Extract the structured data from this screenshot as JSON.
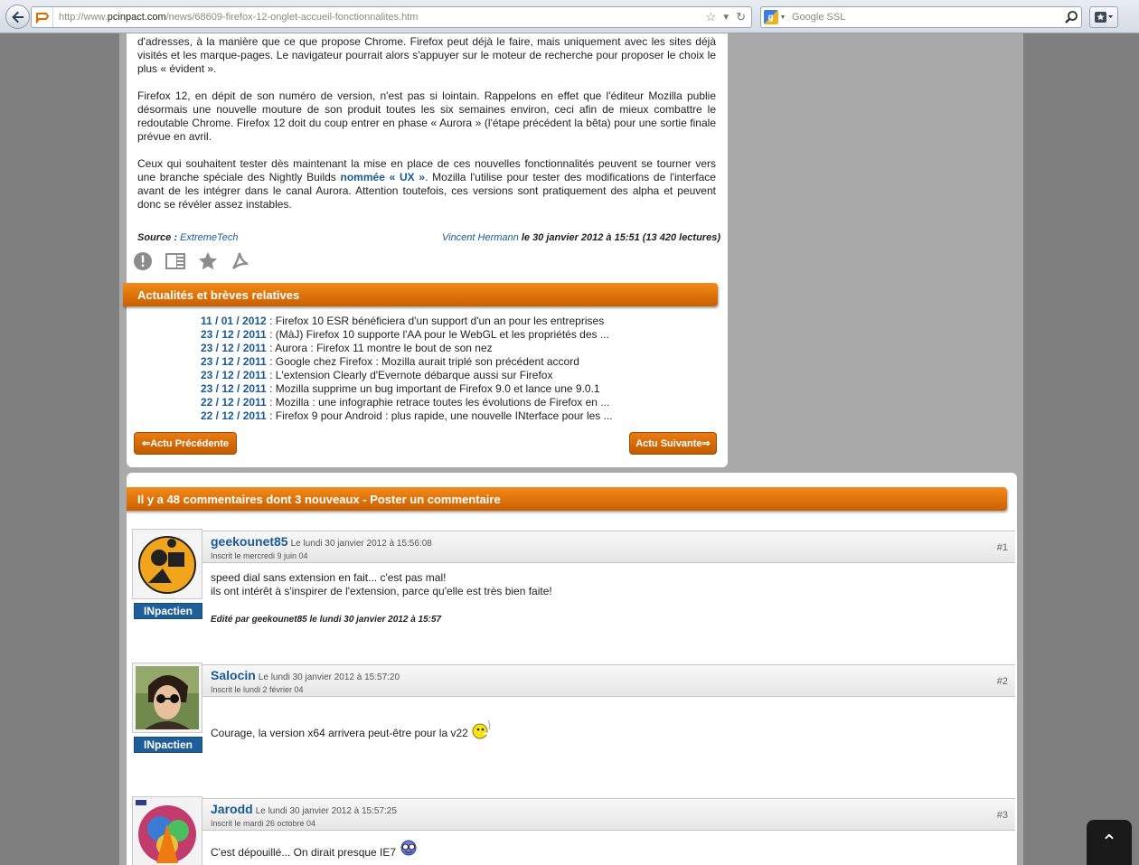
{
  "browser": {
    "url_prefix": "http://www.",
    "url_host": "pcinpact.com",
    "url_path": "/news/68609-firefox-12-onglet-accueil-fonctionnalites.htm",
    "search_placeholder": "Google SSL"
  },
  "article": {
    "para1": "d'adresses, à la manière que ce que propose Chrome. Firefox peut déjà le faire, mais uniquement avec les sites déjà visités et les marque-pages. Le navigateur pourrait alors s'appuyer sur le moteur de recherche pour proposer le choix le plus « évident ».",
    "para2": "Firefox 12, en dépit de son numéro de version, n'est pas si lointain. Rappelons en effet que l'éditeur Mozilla publie désormais une nouvelle mouture de son produit toutes les six semaines environ, ceci afin de mieux combattre le redoutable Chrome. Firefox 12 doit du coup entrer en phase « Aurora » (l'étape précédent la bêta) pour une sortie finale prévue en avril.",
    "para3_before": "Ceux qui souhaitent tester dès maintenant la mise en place de ces nouvelles fonctionnalités peuvent se tourner vers une branche spéciale des Nightly Builds ",
    "para3_link": "nommée « UX »",
    "para3_after": ". Mozilla l'utilise pour tester des modifications de l'interface avant de les intégrer dans le canal Aurora. Attention toutefois, ces versions sont pratiquement des alpha et peuvent donc se révéler assez instables.",
    "source_label": "Source : ",
    "source_link": "ExtremeTech",
    "author": "Vincent Hermann",
    "date_info": " le 30 janvier 2012 à 15:51 (13 420 lectures)"
  },
  "related": {
    "title": "Actualités et brèves relatives",
    "items": [
      {
        "date": "11 / 01 / 2012",
        "text": " : Firefox 10 ESR bénéficiera d'un support d'un an pour les entreprises"
      },
      {
        "date": "23 / 12 / 2011",
        "text": " : (MàJ) Firefox 10 supporte l'AA pour le WebGL et les propriétés des ..."
      },
      {
        "date": "23 / 12 / 2011",
        "text": " : Aurora : Firefox 11 montre le bout de son nez"
      },
      {
        "date": "23 / 12 / 2011",
        "text": " : Google chez Firefox : Mozilla aurait triplé son précédent accord"
      },
      {
        "date": "23 / 12 / 2011",
        "text": " : L'extension Clearly d'Evernote débarque aussi sur Firefox"
      },
      {
        "date": "23 / 12 / 2011",
        "text": " : Mozilla supprime un bug important de Firefox 9.0 et lance une 9.0.1"
      },
      {
        "date": "22 / 12 / 2011",
        "text": " : Mozilla : une infographie retrace toutes les évolutions de Firefox en ..."
      },
      {
        "date": "22 / 12 / 2011",
        "text": " : Firefox 9 pour Android : plus rapide, une nouvelle INterface pour les ..."
      }
    ],
    "prev_label": "⇐Actu Précédente",
    "next_label": "Actu Suivante⇒"
  },
  "comments": {
    "title": "Il y a 48 commentaires dont 3 nouveaux - Poster un commentaire",
    "items": [
      {
        "user": "geekounet85",
        "date": "Le lundi 30 janvier 2012 à 15:56:08",
        "since": "Inscrit le mercredi 9 juin 04",
        "num": "#1",
        "badge": "INpactien",
        "line1": "speed dial sans extension en fait... c'est pas mal!",
        "line2": "ils ont intérêt à s'inspirer de l'extension, parce qu'elle est très bien faite!",
        "edit": "Edité par geekounet85 le lundi 30 janvier 2012 à 15:57"
      },
      {
        "user": "Salocin",
        "date": "Le lundi 30 janvier 2012 à 15:57:20",
        "since": "Inscrit le lundi 2 février 04",
        "num": "#2",
        "badge": "INpactien",
        "line1": "Courage, la version x64 arrivera peut-être pour la v22"
      },
      {
        "user": "Jarodd",
        "date": "Le lundi 30 janvier 2012 à 15:57:25",
        "since": "Inscrit le mardi 26 octobre 04",
        "num": "#3",
        "line1": "C'est dépouillé... On dirait presque IE7"
      }
    ]
  },
  "scroll_top": "⌃"
}
